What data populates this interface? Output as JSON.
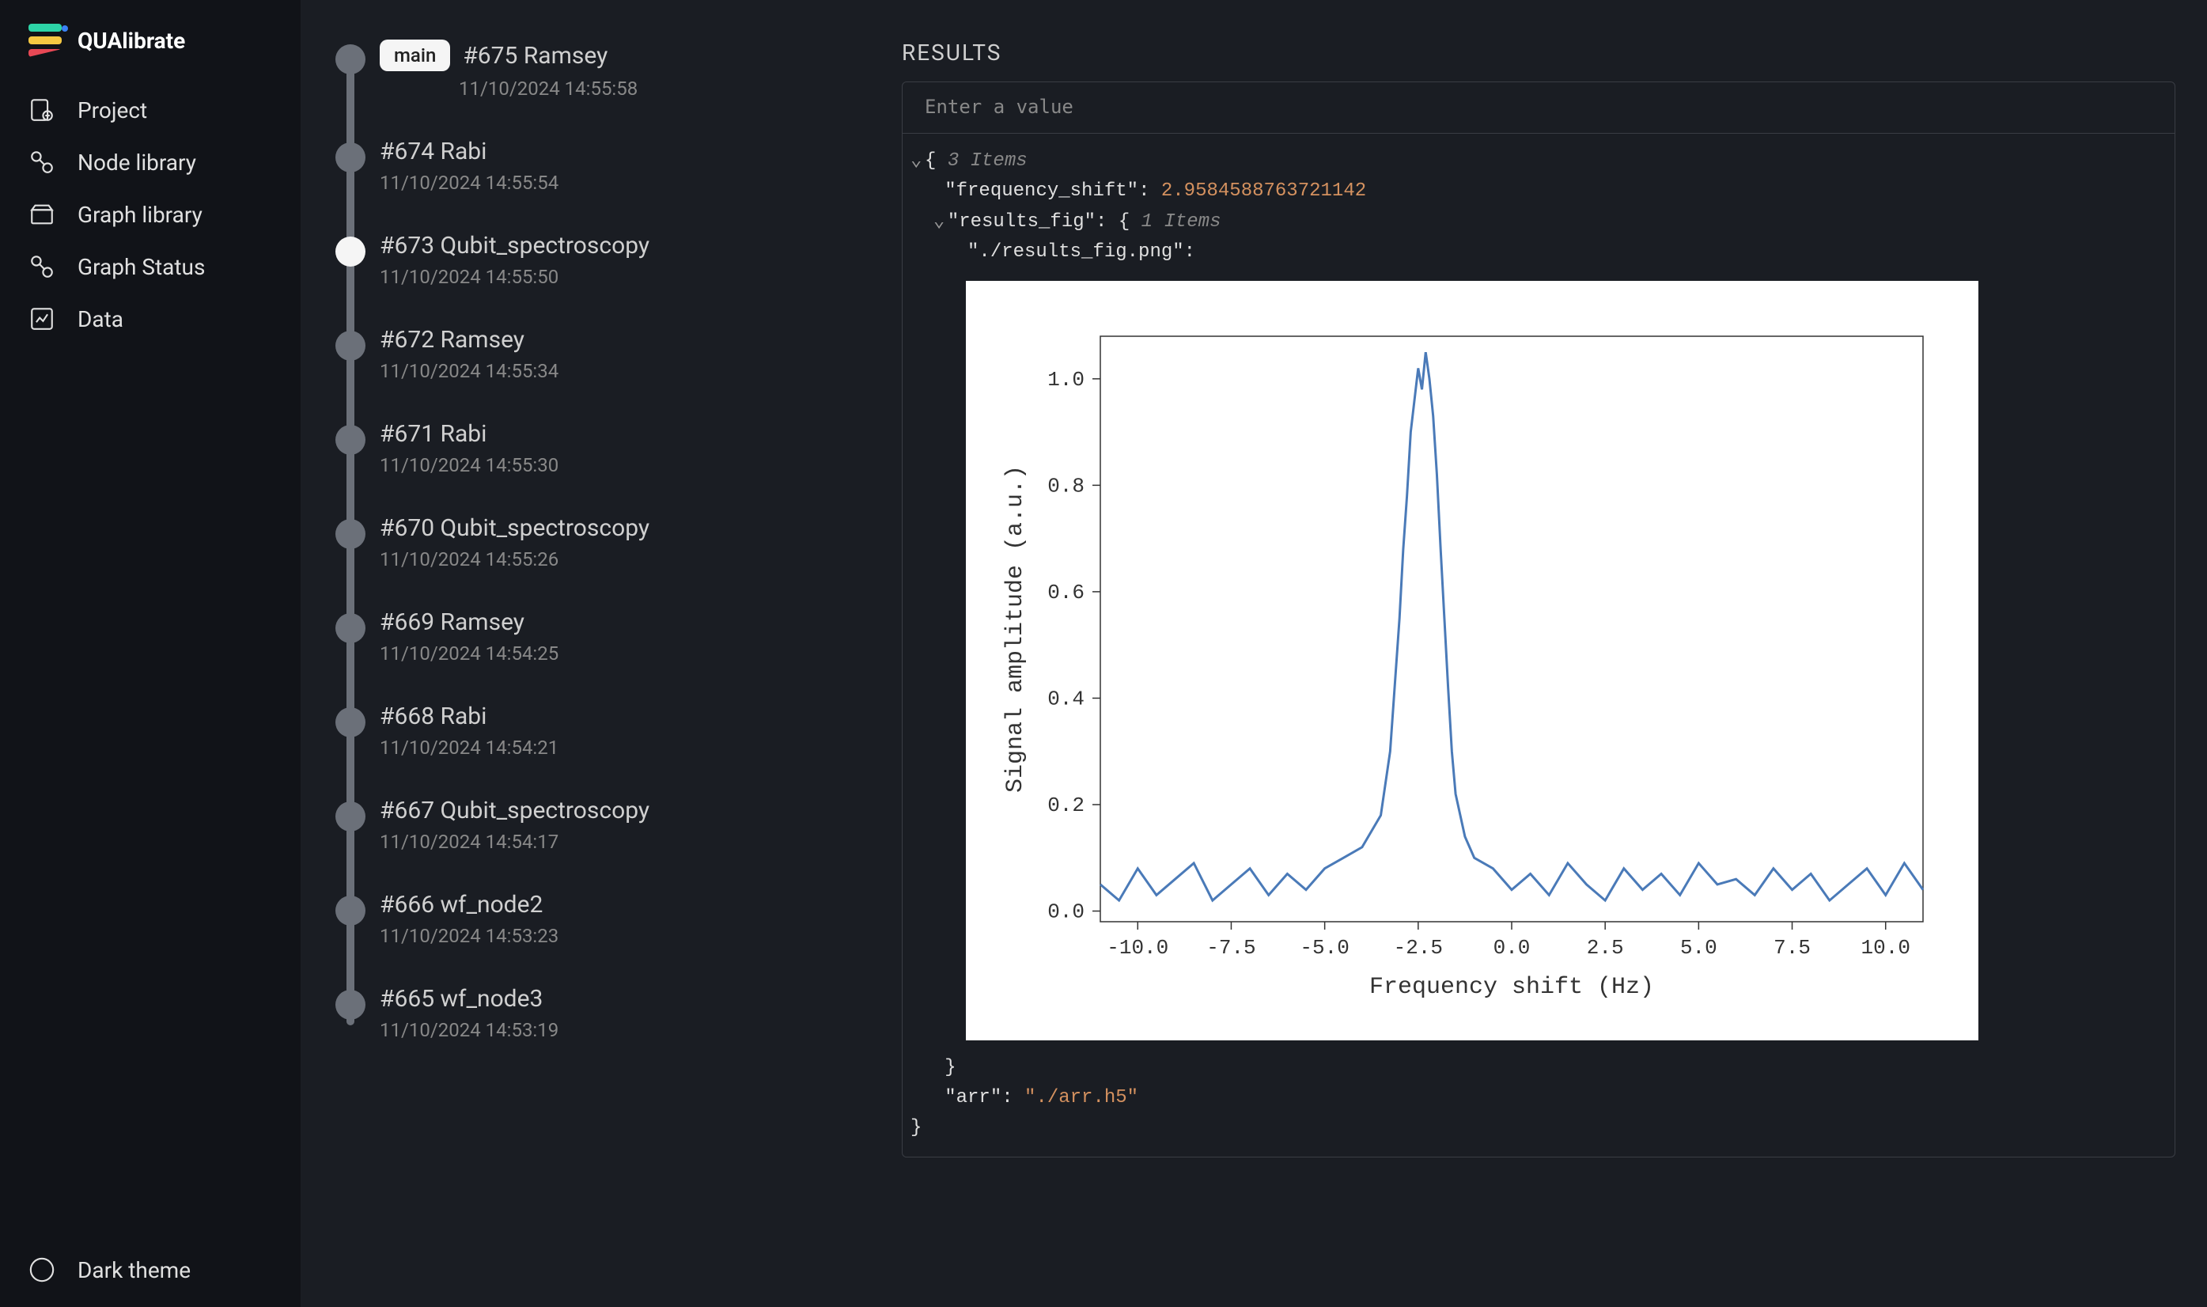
{
  "app_name": "QUAlibrate",
  "sidebar": {
    "nav": [
      {
        "label": "Project",
        "icon": "project-icon"
      },
      {
        "label": "Node library",
        "icon": "node-library-icon"
      },
      {
        "label": "Graph library",
        "icon": "graph-library-icon"
      },
      {
        "label": "Graph Status",
        "icon": "graph-status-icon"
      },
      {
        "label": "Data",
        "icon": "data-icon"
      }
    ],
    "theme_label": "Dark theme"
  },
  "timeline": {
    "main_badge": "main",
    "items": [
      {
        "badge": true,
        "title": "#675 Ramsey",
        "date": "11/10/2024 14:55:58",
        "selected": false
      },
      {
        "badge": false,
        "title": "#674 Rabi",
        "date": "11/10/2024 14:55:54",
        "selected": false
      },
      {
        "badge": false,
        "title": "#673 Qubit_spectroscopy",
        "date": "11/10/2024 14:55:50",
        "selected": true
      },
      {
        "badge": false,
        "title": "#672 Ramsey",
        "date": "11/10/2024 14:55:34",
        "selected": false
      },
      {
        "badge": false,
        "title": "#671 Rabi",
        "date": "11/10/2024 14:55:30",
        "selected": false
      },
      {
        "badge": false,
        "title": "#670 Qubit_spectroscopy",
        "date": "11/10/2024 14:55:26",
        "selected": false
      },
      {
        "badge": false,
        "title": "#669 Ramsey",
        "date": "11/10/2024 14:54:25",
        "selected": false
      },
      {
        "badge": false,
        "title": "#668 Rabi",
        "date": "11/10/2024 14:54:21",
        "selected": false
      },
      {
        "badge": false,
        "title": "#667 Qubit_spectroscopy",
        "date": "11/10/2024 14:54:17",
        "selected": false
      },
      {
        "badge": false,
        "title": "#666 wf_node2",
        "date": "11/10/2024 14:53:23",
        "selected": false
      },
      {
        "badge": false,
        "title": "#665 wf_node3",
        "date": "11/10/2024 14:53:19",
        "selected": false
      }
    ]
  },
  "results": {
    "title": "RESULTS",
    "input_placeholder": "Enter a value",
    "json": {
      "root_count": "3 Items",
      "frequency_shift_key": "\"frequency_shift\"",
      "frequency_shift_val": "2.9584588763721142",
      "results_fig_key": "\"results_fig\"",
      "results_fig_count": "1 Items",
      "results_fig_path_key": "\"./results_fig.png\"",
      "arr_key": "\"arr\"",
      "arr_val": "\"./arr.h5\""
    }
  },
  "chart_data": {
    "type": "line",
    "title": "",
    "xlabel": "Frequency shift (Hz)",
    "ylabel": "Signal amplitude (a.u.)",
    "xlim": [
      -11,
      11
    ],
    "ylim": [
      -0.02,
      1.08
    ],
    "xticks": [
      -10.0,
      -7.5,
      -5.0,
      -2.5,
      0.0,
      2.5,
      5.0,
      7.5,
      10.0
    ],
    "yticks": [
      0.0,
      0.2,
      0.4,
      0.6,
      0.8,
      1.0
    ],
    "x": [
      -11,
      -10.5,
      -10,
      -9.5,
      -9,
      -8.5,
      -8,
      -7.5,
      -7,
      -6.5,
      -6,
      -5.5,
      -5,
      -4.5,
      -4,
      -3.5,
      -3.25,
      -3.0,
      -2.9,
      -2.8,
      -2.7,
      -2.6,
      -2.5,
      -2.4,
      -2.3,
      -2.2,
      -2.1,
      -2.0,
      -1.9,
      -1.8,
      -1.7,
      -1.6,
      -1.5,
      -1.25,
      -1.0,
      -0.5,
      0,
      0.5,
      1,
      1.5,
      2,
      2.5,
      3,
      3.5,
      4,
      4.5,
      5,
      5.5,
      6,
      6.5,
      7,
      7.5,
      8,
      8.5,
      9,
      9.5,
      10,
      10.5,
      11
    ],
    "y": [
      0.05,
      0.02,
      0.08,
      0.03,
      0.06,
      0.09,
      0.02,
      0.05,
      0.08,
      0.03,
      0.07,
      0.04,
      0.08,
      0.1,
      0.12,
      0.18,
      0.3,
      0.55,
      0.68,
      0.78,
      0.9,
      0.96,
      1.02,
      0.98,
      1.05,
      1.0,
      0.93,
      0.82,
      0.68,
      0.55,
      0.42,
      0.3,
      0.22,
      0.14,
      0.1,
      0.08,
      0.04,
      0.07,
      0.03,
      0.09,
      0.05,
      0.02,
      0.08,
      0.04,
      0.07,
      0.03,
      0.09,
      0.05,
      0.06,
      0.03,
      0.08,
      0.04,
      0.07,
      0.02,
      0.05,
      0.08,
      0.03,
      0.09,
      0.04
    ],
    "line_color": "#4a7ab8"
  }
}
